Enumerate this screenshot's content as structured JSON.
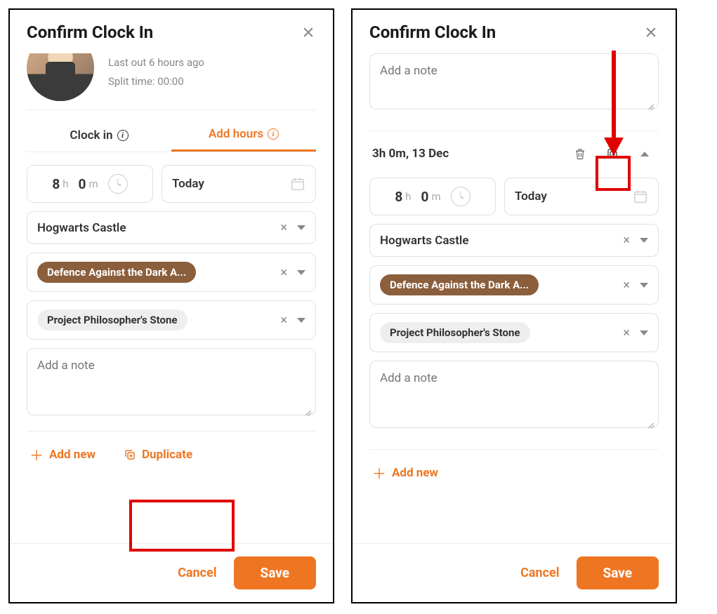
{
  "left": {
    "title": "Confirm Clock In",
    "avatar": {
      "last_out": "Last out 6 hours ago",
      "split_time": "Split time: 00:00"
    },
    "tabs": {
      "clock_in": "Clock in",
      "add_hours": "Add hours"
    },
    "time": {
      "h_val": "8",
      "h_unit": "h",
      "m_val": "0",
      "m_unit": "m"
    },
    "date_label": "Today",
    "location": "Hogwarts Castle",
    "activity": "Defence Against the Dark A...",
    "project": "Project Philosopher's Stone",
    "note_placeholder": "Add a note",
    "add_new": "Add new",
    "duplicate": "Duplicate",
    "cancel": "Cancel",
    "save": "Save"
  },
  "right": {
    "title": "Confirm Clock In",
    "note_placeholder_top": "Add a note",
    "entry_title": "3h 0m, 13 Dec",
    "time": {
      "h_val": "8",
      "h_unit": "h",
      "m_val": "0",
      "m_unit": "m"
    },
    "date_label": "Today",
    "location": "Hogwarts Castle",
    "activity": "Defence Against the Dark A...",
    "project": "Project Philosopher's Stone",
    "note_placeholder": "Add a note",
    "add_new": "Add new",
    "cancel": "Cancel",
    "save": "Save"
  }
}
